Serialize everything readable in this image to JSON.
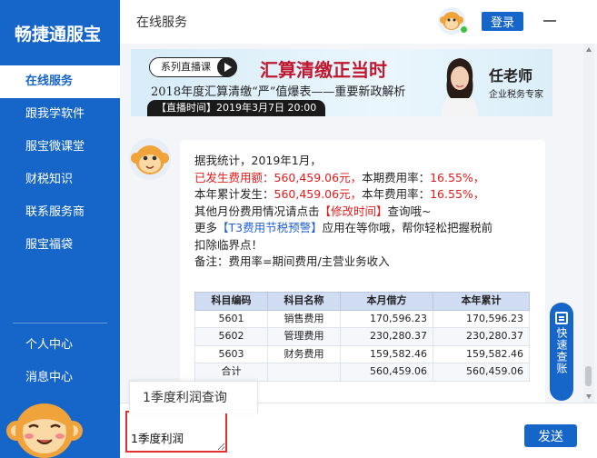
{
  "app": {
    "logo_text": "畅捷通服宝",
    "window_title": "在线服务",
    "login_label": "登录"
  },
  "sidebar": {
    "items": [
      {
        "label": "在线服务",
        "active": true
      },
      {
        "label": "跟我学软件"
      },
      {
        "label": "服宝微课堂"
      },
      {
        "label": "财税知识"
      },
      {
        "label": "联系服务商"
      },
      {
        "label": "服宝福袋"
      }
    ],
    "bottom_items": [
      {
        "label": "个人中心"
      },
      {
        "label": "消息中心"
      }
    ]
  },
  "banner": {
    "tag": "系列直播课",
    "headline": "汇算清缴正当时",
    "subtitle": "2018年度汇算清缴“严”值爆表——重要新政解析",
    "time_label": "【直播时间】2019年3月7日 20:00",
    "teacher": "任老师",
    "teacher_role": "企业税务专家"
  },
  "message": {
    "line1": "据我统计，2019年1月，",
    "line2_prefix": "已发生费用额：",
    "line2_amount": "560,459.06元，",
    "line2_rate_label": "本期费用率：",
    "line2_rate": "16.55%，",
    "line3_prefix": "本年累计发生：",
    "line3_amount": "560,459.06元，",
    "line3_rate_label": "本年费用率：",
    "line3_rate": "16.55%，",
    "line4_prefix": "其他月份费用情况请点击",
    "line4_link": "【修改时间】",
    "line4_suffix": "查询哦~",
    "line5_prefix": "更多",
    "line5_link": "【T3费用节税预警】",
    "line5_suffix": "应用在等你哦，帮你轻松把握税前",
    "line6": "扣除临界点！",
    "line7": "备注：费用率=期间费用/主营业务收入"
  },
  "table": {
    "headers": [
      "科目编码",
      "科目名称",
      "本月借方",
      "本年累计"
    ],
    "rows": [
      [
        "5601",
        "销售费用",
        "170,596.23",
        "170,596.23"
      ],
      [
        "5602",
        "管理费用",
        "230,280.37",
        "230,280.37"
      ],
      [
        "5603",
        "财务费用",
        "159,582.46",
        "159,582.46"
      ],
      [
        "合计",
        "",
        "560,459.06",
        "560,459.06"
      ]
    ]
  },
  "float_bar": {
    "label": "快速查账"
  },
  "suggestion": {
    "text": "1季度利润查询"
  },
  "input": {
    "value": "1季度利润"
  },
  "send_label": "发送",
  "colors": {
    "brand_blue": "#1665c9",
    "highlight_red": "#e21b1b",
    "link_blue": "#1f5fd6",
    "input_border_red": "#e0322f"
  }
}
